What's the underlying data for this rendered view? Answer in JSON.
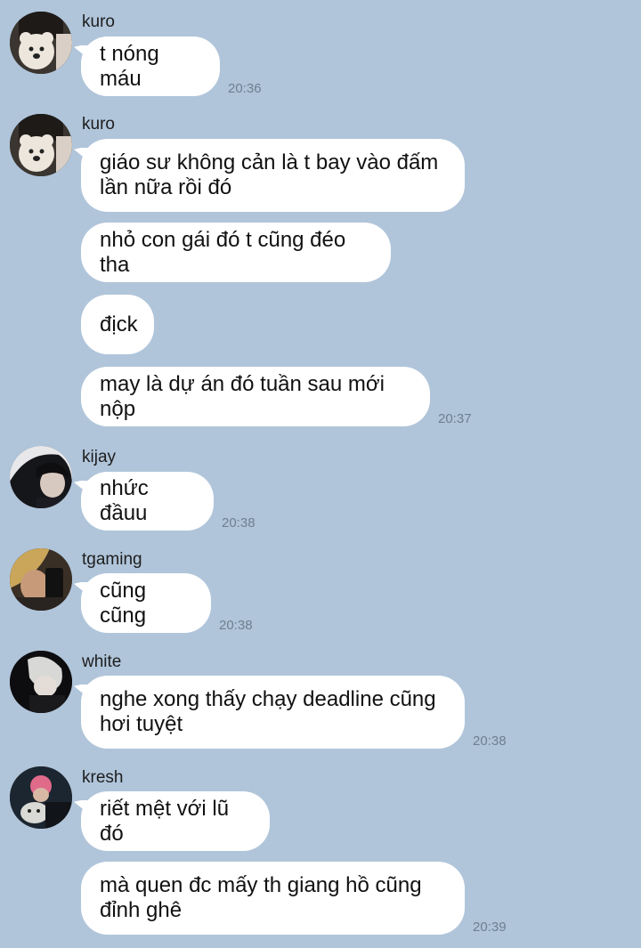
{
  "messages": [
    {
      "sender": "kuro",
      "bubbles": [
        "t nóng máu"
      ],
      "time": "20:36"
    },
    {
      "sender": "kuro",
      "bubbles": [
        "giáo sư không cản là t bay vào đấm lần nữa rồi đó",
        "nhỏ con gái đó t cũng đéo tha",
        "địck",
        "may là dự án đó tuần sau mới nộp"
      ],
      "time": "20:37"
    },
    {
      "sender": "kijay",
      "bubbles": [
        "nhức đầuu"
      ],
      "time": "20:38"
    },
    {
      "sender": "tgaming",
      "bubbles": [
        "cũng cũng"
      ],
      "time": "20:38"
    },
    {
      "sender": "white",
      "bubbles": [
        "nghe xong thấy chạy deadline cũng hơi tuyệt"
      ],
      "time": "20:38"
    },
    {
      "sender": "kresh",
      "bubbles": [
        "riết mệt với lũ đó",
        "mà quen đc mấy th giang hồ cũng đỉnh ghê"
      ],
      "time": "20:39"
    }
  ],
  "colors": {
    "background": "#b0c5da",
    "bubble": "#ffffff",
    "timestamp": "#6f7f8f"
  },
  "icons": {
    "avatar": "profile-photo"
  }
}
